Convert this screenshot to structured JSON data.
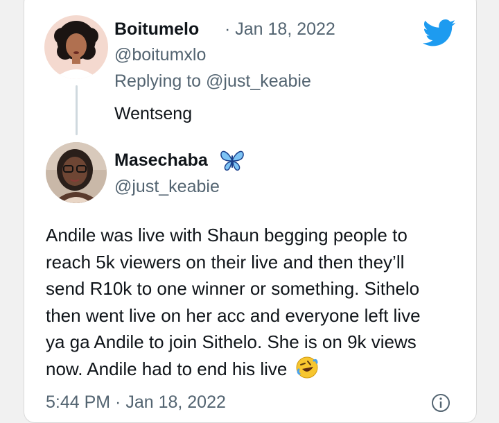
{
  "reply_tweet": {
    "author_name": "Boitumelo",
    "date_line": "· Jan 18, 2022",
    "handle": "@boitumxlo",
    "replying_prefix": "Replying to",
    "replying_to": "@just_keabie",
    "text": "Wentseng",
    "avatar_icon": "cartoon-woman-avatar"
  },
  "quoted_tweet": {
    "author_name": "Masechaba",
    "name_emoji": "butterfly-icon",
    "handle": "@just_keabie",
    "avatar_icon": "woman-with-glasses-photo",
    "lines": [
      "Andile was live with Shaun begging people to",
      "reach 5k viewers on their live and then they’ll",
      "send R10k to one winner or something. Sithelo",
      "then went live on her acc and everyone left live",
      "ya ga Andile to join Sithelo. She is on 9k views",
      "now. Andile had to end his live"
    ],
    "end_emoji": "rolling-on-floor-laughing-icon",
    "footer": "5:44 PM · Jan 18, 2022"
  },
  "brand_icon": "twitter-bird-icon",
  "colors": {
    "twitter_blue": "#1d9bf0",
    "text": "#0f1419",
    "muted": "#536471"
  }
}
